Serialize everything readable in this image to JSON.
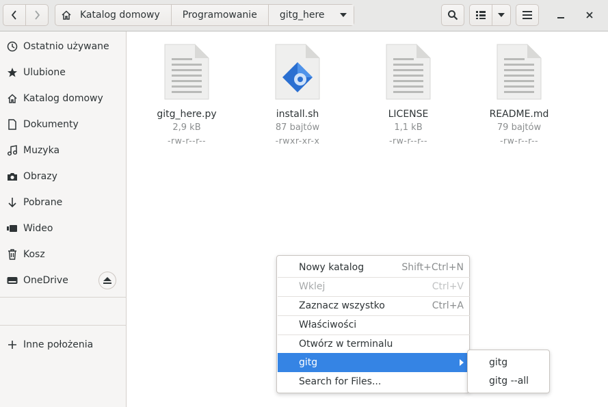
{
  "headerbar": {
    "breadcrumbs": [
      "Katalog domowy",
      "Programowanie",
      "gitg_here"
    ],
    "icons": {
      "back": "go-back-icon",
      "forward": "go-forward-icon",
      "home": "home-icon",
      "search": "search-icon",
      "view": "list-view-icon",
      "view_dropdown": "chevron-down-icon",
      "menu": "hamburger-menu-icon",
      "minimize": "minimize-icon",
      "close": "close-icon"
    }
  },
  "sidebar": {
    "items": [
      {
        "label": "Ostatnio używane",
        "icon": "recent-clock-icon"
      },
      {
        "label": "Ulubione",
        "icon": "star-icon"
      },
      {
        "label": "Katalog domowy",
        "icon": "home-icon"
      },
      {
        "label": "Dokumenty",
        "icon": "document-icon"
      },
      {
        "label": "Muzyka",
        "icon": "music-note-icon"
      },
      {
        "label": "Obrazy",
        "icon": "camera-icon"
      },
      {
        "label": "Pobrane",
        "icon": "download-arrow-icon"
      },
      {
        "label": "Wideo",
        "icon": "video-icon"
      },
      {
        "label": "Kosz",
        "icon": "trash-icon"
      },
      {
        "label": "OneDrive",
        "icon": "drive-icon"
      }
    ],
    "other_locations": {
      "label": "Inne położenia",
      "icon": "plus-icon"
    }
  },
  "files": [
    {
      "name": "gitg_here.py",
      "size": "2,9 kB",
      "perms": "-rw-r--r--",
      "icon": "text-file-icon"
    },
    {
      "name": "install.sh",
      "size": "87 bajtów",
      "perms": "-rwxr-xr-x",
      "icon": "shell-script-icon"
    },
    {
      "name": "LICENSE",
      "size": "1,1 kB",
      "perms": "-rw-r--r--",
      "icon": "text-file-icon"
    },
    {
      "name": "README.md",
      "size": "79 bajtów",
      "perms": "-rw-r--r--",
      "icon": "text-file-icon"
    }
  ],
  "context_menu": {
    "items": [
      {
        "label": "Nowy katalog",
        "accel": "Shift+Ctrl+N"
      },
      {
        "label": "Wklej",
        "accel": "Ctrl+V"
      },
      {
        "label": "Zaznacz wszystko",
        "accel": "Ctrl+A"
      },
      {
        "label": "Właściwości",
        "accel": ""
      },
      {
        "label": "Otwórz w terminalu",
        "accel": ""
      },
      {
        "label": "gitg",
        "accel": ""
      },
      {
        "label": "Search for Files...",
        "accel": ""
      }
    ],
    "submenu": [
      "gitg",
      "gitg --all"
    ]
  },
  "colors": {
    "accent": "#3584e4",
    "sidebar_bg": "#f6f5f4",
    "header_bg": "#e8e8e7"
  }
}
